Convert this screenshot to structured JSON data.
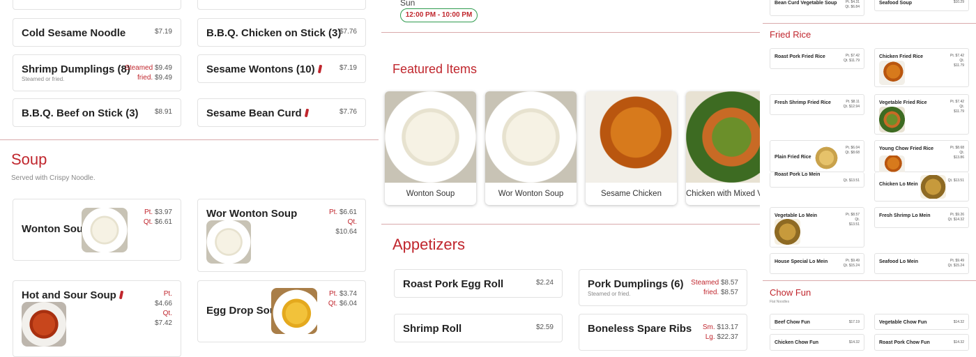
{
  "appetizers_top": {
    "items": [
      {
        "name": "Cold Sesame Noodle",
        "price": "$7.19"
      },
      {
        "name": "B.B.Q. Chicken on Stick (3)",
        "price": "$7.76"
      },
      {
        "name": "Shrimp Dumplings (8)",
        "sub": "Steamed or fried.",
        "opt1_label": "Steamed",
        "opt1_price": "$9.49",
        "opt2_label": "fried.",
        "opt2_price": "$9.49"
      },
      {
        "name": "Sesame Wontons (10)",
        "price": "$7.19"
      },
      {
        "name": "B.B.Q. Beef on Stick (3)",
        "price": "$8.91"
      },
      {
        "name": "Sesame Bean Curd",
        "price": "$7.76"
      }
    ]
  },
  "soup": {
    "title": "Soup",
    "subtitle": "Served with Crispy Noodle.",
    "items": [
      {
        "name": "Wonton Soup",
        "pt": "Pt.",
        "pt_price": "$3.97",
        "qt": "Qt.",
        "qt_price": "$6.61"
      },
      {
        "name": "Wor Wonton Soup",
        "pt": "Pt.",
        "pt_price": "$6.61",
        "qt": "Qt.",
        "qt_price": "$10.64"
      },
      {
        "name": "Hot and Sour Soup",
        "pt": "Pt.",
        "pt_price": "$4.66",
        "qt": "Qt.",
        "qt_price": "$7.42"
      },
      {
        "name": "Egg Drop Soup",
        "pt": "Pt.",
        "pt_price": "$3.74",
        "qt": "Qt.",
        "qt_price": "$6.04"
      }
    ]
  },
  "hours": {
    "day": "Sun",
    "time": "12:00 PM - 10:00 PM"
  },
  "featured": {
    "title": "Featured Items",
    "items": [
      {
        "name": "Wonton Soup"
      },
      {
        "name": "Wor Wonton Soup"
      },
      {
        "name": "Sesame Chicken"
      },
      {
        "name": "Chicken with Mixed Vegetables"
      }
    ]
  },
  "appetizers": {
    "title": "Appetizers",
    "items": [
      {
        "name": "Roast Pork Egg Roll",
        "price": "$2.24"
      },
      {
        "name": "Pork Dumplings (6)",
        "sub": "Steamed or fried.",
        "opt1_label": "Steamed",
        "opt1_price": "$8.57",
        "opt2_label": "fried.",
        "opt2_price": "$8.57"
      },
      {
        "name": "Shrimp Roll",
        "price": "$2.59"
      },
      {
        "name": "Boneless Spare Ribs",
        "opt1_label": "Sm.",
        "opt1_price": "$13.17",
        "opt2_label": "Lg.",
        "opt2_price": "$22.37"
      }
    ]
  },
  "right": {
    "top_items": [
      {
        "name": "Bean Curd Vegetable Soup",
        "l1": "Pt. $4.31",
        "l2": "Qt. $6.84"
      },
      {
        "name": "Seafood Soup",
        "l1": "$10.29"
      }
    ],
    "fried_rice": {
      "title": "Fried Rice",
      "items": [
        {
          "name": "Roast Pork Fried Rice",
          "l1": "Pt. $7.42",
          "l2": "Qt. $11.79"
        },
        {
          "name": "Chicken Fried Rice",
          "l1": "Pt. $7.42",
          "l2": "Qt.",
          "l3": "$11.79"
        },
        {
          "name": "Fresh Shrimp Fried Rice",
          "l1": "Pt. $8.11",
          "l2": "Qt. $12.94"
        },
        {
          "name": "Vegetable Fried Rice",
          "l1": "Pt. $7.42",
          "l2": "Qt.",
          "l3": "$11.79"
        },
        {
          "name": "Plain Fried Rice",
          "l1": "Pt. $6.04",
          "l2": "Qt. $8.68"
        },
        {
          "name": "Young Chow Fried Rice",
          "l1": "Pt. $8.68",
          "l2": "Qt.",
          "l3": "$13.86"
        }
      ]
    },
    "lo_mein": {
      "items": [
        {
          "name": "Roast Pork Lo Mein",
          "l1": "Qt. $13.51"
        },
        {
          "name": "Chicken Lo Mein",
          "l1": "Qt. $13.51"
        },
        {
          "name": "Vegetable Lo Mein",
          "l1": "Pt. $8.57",
          "l2": "Qt.",
          "l3": "$13.51"
        },
        {
          "name": "Fresh Shrimp Lo Mein",
          "l1": "Pt. $9.26",
          "l2": "Qt. $14.32"
        },
        {
          "name": "House Special Lo Mein",
          "l1": "Pt. $9.49",
          "l2": "Qt. $15.24"
        },
        {
          "name": "Seafood Lo Mein",
          "l1": "Pt. $9.49",
          "l2": "Qt. $15.24"
        }
      ]
    },
    "chow_fun": {
      "title": "Chow Fun",
      "subtitle": "Flat Noodles",
      "items": [
        {
          "name": "Beef Chow Fun",
          "l1": "$17.19"
        },
        {
          "name": "Vegetable Chow Fun",
          "l1": "$14.32"
        },
        {
          "name": "Chicken Chow Fun",
          "l1": "$14.32"
        },
        {
          "name": "Roast Pork Chow Fun",
          "l1": "$14.32"
        }
      ]
    }
  },
  "colors": {
    "accent": "#c0262d",
    "hours_badge": "#2e9b4e"
  }
}
